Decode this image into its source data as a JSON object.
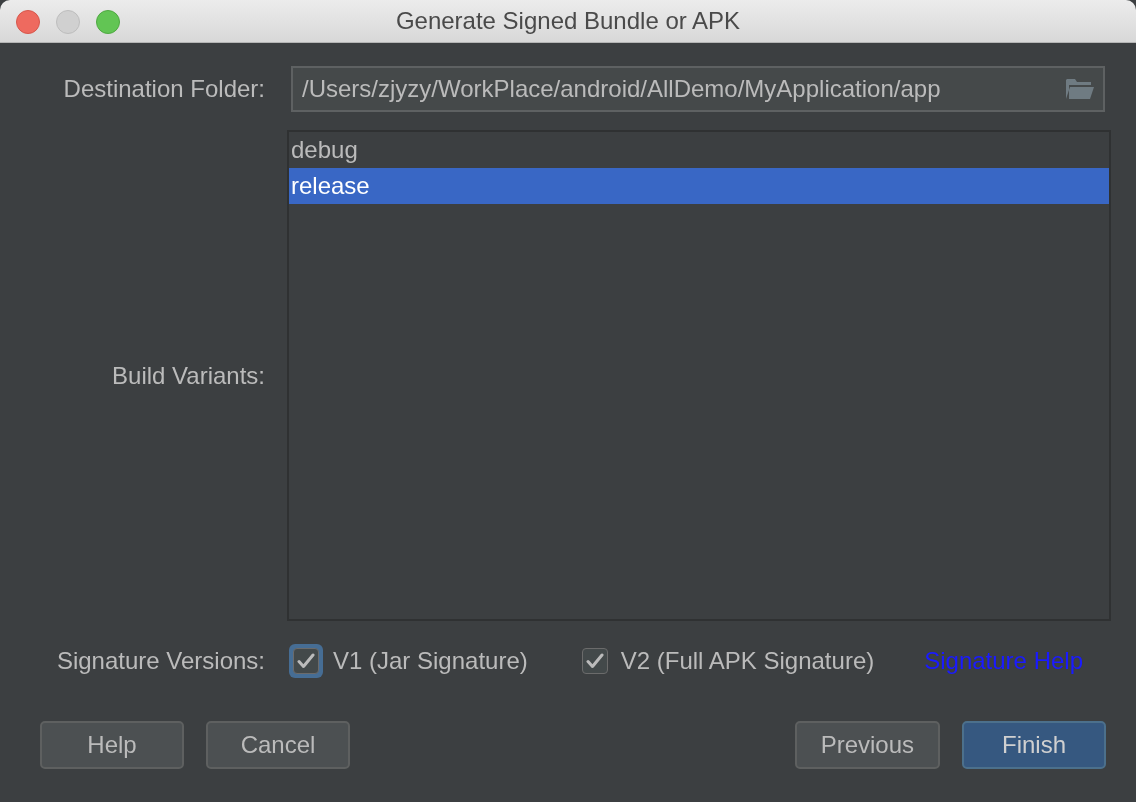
{
  "window": {
    "title": "Generate Signed Bundle or APK",
    "controls": [
      {
        "kind": "close",
        "disabled": false
      },
      {
        "kind": "minimize",
        "disabled": true
      },
      {
        "kind": "zoom",
        "disabled": false
      }
    ]
  },
  "destination_folder": {
    "label": "Destination Folder:",
    "value": "/Users/zjyzy/WorkPlace/android/AllDemo/MyApplication/app"
  },
  "build_variants": {
    "label": "Build Variants:",
    "items": [
      {
        "label": "debug",
        "selected": false
      },
      {
        "label": "release",
        "selected": true
      }
    ]
  },
  "signature_versions": {
    "label": "Signature Versions:",
    "options": [
      {
        "label": "V1 (Jar Signature)",
        "checked": true,
        "focused": true
      },
      {
        "label": "V2 (Full APK Signature)",
        "checked": true,
        "focused": false
      }
    ],
    "help_link": "Signature Help"
  },
  "left_buttons": [
    {
      "label": "Help",
      "default": false
    },
    {
      "label": "Cancel",
      "default": false
    }
  ],
  "right_buttons": [
    {
      "label": "Previous",
      "default": false
    },
    {
      "label": "Finish",
      "default": true
    }
  ]
}
